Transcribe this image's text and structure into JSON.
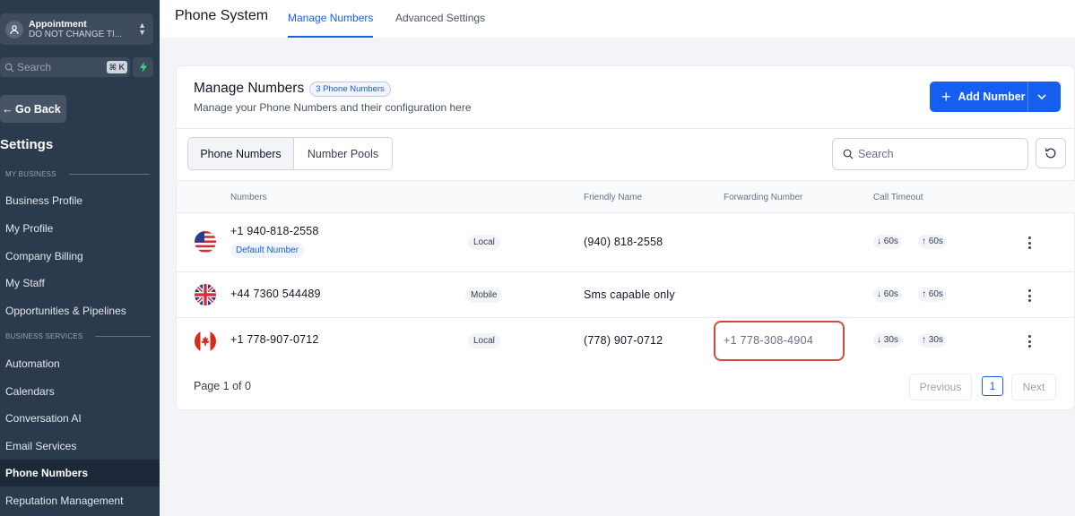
{
  "sidebar": {
    "location": {
      "name": "Appointment",
      "subtitle": "DO NOT CHANGE TI..."
    },
    "search": {
      "label": "Search",
      "shortcut": "⌘ K"
    },
    "go_back": "Go Back",
    "settings_title": "Settings",
    "section_my_business": "MY BUSINESS",
    "section_business_services": "BUSINESS SERVICES",
    "items": [
      {
        "label": "Business Profile"
      },
      {
        "label": "My Profile"
      },
      {
        "label": "Company Billing"
      },
      {
        "label": "My Staff"
      },
      {
        "label": "Opportunities & Pipelines"
      },
      {
        "label": "Automation"
      },
      {
        "label": "Calendars"
      },
      {
        "label": "Conversation AI"
      },
      {
        "label": "Email Services"
      },
      {
        "label": "Phone Numbers",
        "active": true
      },
      {
        "label": "Reputation Management"
      }
    ]
  },
  "header": {
    "title": "Phone System",
    "tabs": [
      {
        "label": "Manage Numbers",
        "active": true
      },
      {
        "label": "Advanced Settings"
      }
    ]
  },
  "card": {
    "title": "Manage Numbers",
    "count_badge": "3 Phone Numbers",
    "subtitle": "Manage your Phone Numbers and their configuration here",
    "add_button": "Add Number",
    "segments": [
      "Phone Numbers",
      "Number Pools"
    ],
    "search_placeholder": "Search",
    "columns": {
      "numbers": "Numbers",
      "friendly": "Friendly Name",
      "forwarding": "Forwarding Number",
      "timeout": "Call Timeout"
    },
    "rows": [
      {
        "flag": "us-flag-icon",
        "number": "+1 940-818-2558",
        "badge": "Default Number",
        "type": "Local",
        "friendly": "(940) 818-2558",
        "forwarding": "",
        "timeout_in": "60s",
        "timeout_out": "60s"
      },
      {
        "flag": "uk-flag-icon",
        "number": "+44 7360 544489",
        "badge": "",
        "type": "Mobile",
        "friendly": "Sms capable only",
        "forwarding": "",
        "timeout_in": "60s",
        "timeout_out": "60s"
      },
      {
        "flag": "canada-flag-icon",
        "number": "+1 778-907-0712",
        "badge": "",
        "type": "Local",
        "friendly": "(778) 907-0712",
        "forwarding": "+1 778-308-4904",
        "timeout_in": "30s",
        "timeout_out": "30s"
      }
    ],
    "pagination": {
      "info": "Page 1 of 0",
      "previous": "Previous",
      "current": "1",
      "next": "Next"
    }
  },
  "colors": {
    "accent": "#155eef",
    "sidebar_bg": "#2c3a4e",
    "highlight": "#d6493a"
  }
}
